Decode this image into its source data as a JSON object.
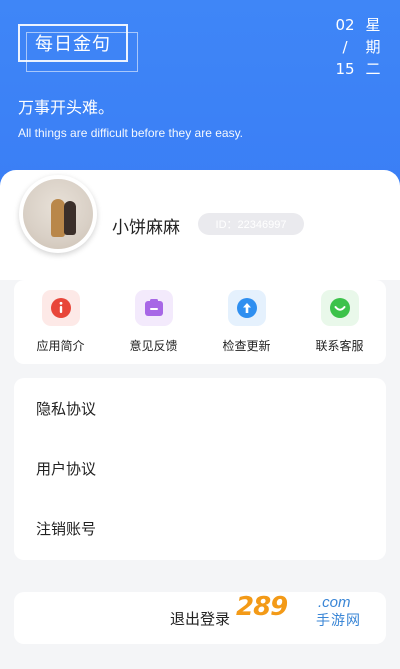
{
  "header": {
    "quote_title": "每日金句",
    "date": {
      "month": "02",
      "day": "15",
      "weekday_chars": [
        "星",
        "期",
        "二"
      ],
      "separator": "/"
    },
    "quote_cn": "万事开头难。",
    "quote_en": "All things are difficult before they are easy."
  },
  "profile": {
    "username": "小饼麻麻",
    "id_label": "ID：22346997"
  },
  "actions": [
    {
      "label": "应用简介",
      "icon": "info-icon",
      "color": "#e8463a",
      "bg": "#fde9e7"
    },
    {
      "label": "意见反馈",
      "icon": "feedback-icon",
      "color": "#a767e6",
      "bg": "#f3eafc"
    },
    {
      "label": "检查更新",
      "icon": "upload-icon",
      "color": "#2f8ff0",
      "bg": "#e5f1fd"
    },
    {
      "label": "联系客服",
      "icon": "chat-icon",
      "color": "#3cc24a",
      "bg": "#e9f8ea"
    }
  ],
  "menu": [
    {
      "label": "隐私协议"
    },
    {
      "label": "用户协议"
    },
    {
      "label": "注销账号"
    }
  ],
  "logout_label": "退出登录",
  "watermark": {
    "main": "289",
    "com": ".com",
    "cn": "手游网"
  },
  "colors": {
    "header_blue": "#3f86f7",
    "page_bg": "#f4f5f7",
    "watermark_orange": "#f39a17",
    "watermark_blue": "#3a86d6"
  }
}
